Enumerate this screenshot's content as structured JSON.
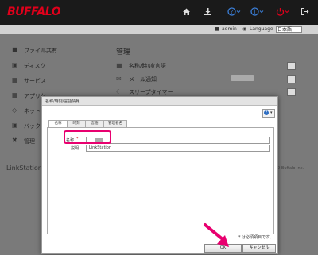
{
  "header": {
    "logo": "BUFFALO",
    "icons": [
      "home-icon",
      "download-icon",
      "help-icon",
      "info-icon",
      "power-icon",
      "logout-icon"
    ]
  },
  "userbar": {
    "user_label": "admin",
    "language_label": "Language",
    "language_value": "日本語"
  },
  "sidebar": {
    "items": [
      {
        "label": "ファイル共有",
        "icon": "folder-icon"
      },
      {
        "label": "ディスク",
        "icon": "disk-icon"
      },
      {
        "label": "サービス",
        "icon": "service-icon"
      },
      {
        "label": "アプリケ",
        "icon": "app-icon"
      },
      {
        "label": "ネット",
        "icon": "network-icon"
      },
      {
        "label": "バック",
        "icon": "backup-icon"
      },
      {
        "label": "管理",
        "icon": "tools-icon"
      }
    ]
  },
  "main": {
    "title": "管理",
    "items": [
      {
        "label": "名称/時刻/言語",
        "icon": "nas-icon"
      },
      {
        "label": "メール通知",
        "icon": "mail-icon"
      },
      {
        "label": "スリープタイマー",
        "icon": "sleep-icon"
      }
    ]
  },
  "footer": {
    "device_name": "LinkStation",
    "copyright": "© 2019 Buffalo Inc."
  },
  "dialog": {
    "title": "名称/時刻/言語情報",
    "tabs": [
      "名称",
      "時刻",
      "言語",
      "管理者名"
    ],
    "name_label": "名称",
    "required_mark": "*",
    "desc_label": "説明",
    "desc_value": "LinkStation",
    "required_note": "* は必須項目です。",
    "ok_label": "OK",
    "cancel_label": "キャンセル"
  },
  "colors": {
    "brand": "#e0001b",
    "highlight": "#e8006f",
    "help_blue": "#2a6bc1"
  }
}
